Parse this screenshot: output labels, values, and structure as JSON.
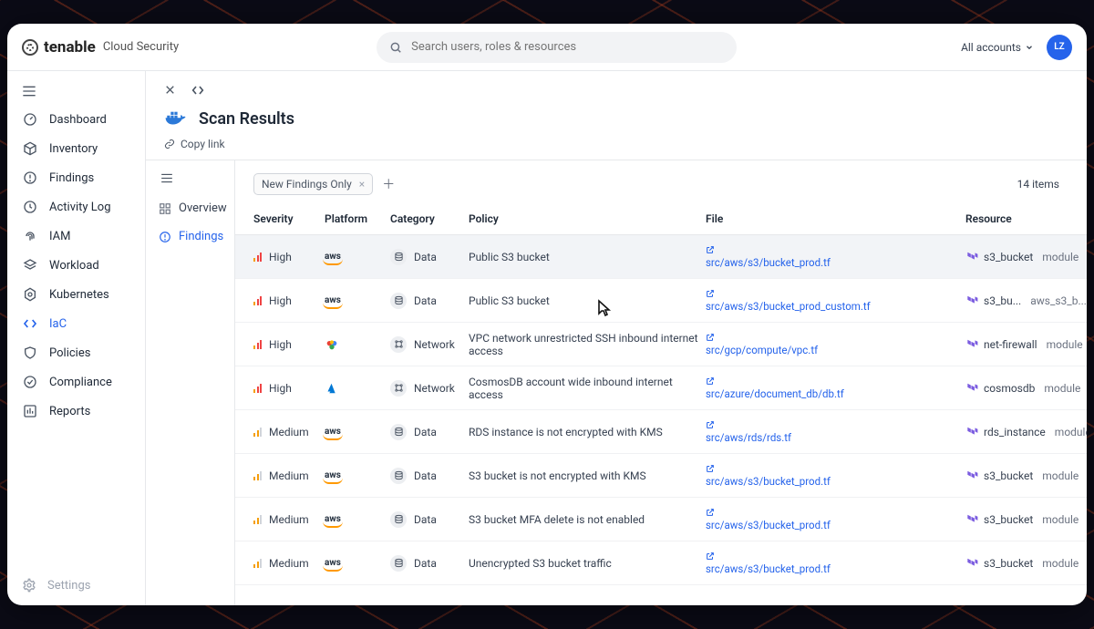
{
  "brand": {
    "name": "tenable",
    "sub": "Cloud Security"
  },
  "search": {
    "placeholder": "Search users, roles & resources"
  },
  "account": {
    "label": "All accounts",
    "avatar": "LZ"
  },
  "sidebar": {
    "items": [
      {
        "label": "Dashboard"
      },
      {
        "label": "Inventory"
      },
      {
        "label": "Findings"
      },
      {
        "label": "Activity Log"
      },
      {
        "label": "IAM"
      },
      {
        "label": "Workload"
      },
      {
        "label": "Kubernetes"
      },
      {
        "label": "IaC"
      },
      {
        "label": "Policies"
      },
      {
        "label": "Compliance"
      },
      {
        "label": "Reports"
      }
    ],
    "settings": "Settings"
  },
  "page": {
    "title": "Scan Results",
    "copy": "Copy link"
  },
  "subnav": {
    "overview": "Overview",
    "findings": "Findings"
  },
  "filter": {
    "chip": "New Findings Only",
    "count": "14 items"
  },
  "columns": {
    "severity": "Severity",
    "platform": "Platform",
    "category": "Category",
    "policy": "Policy",
    "file": "File",
    "resource": "Resource"
  },
  "labels": {
    "high": "High",
    "medium": "Medium",
    "data": "Data",
    "network": "Network",
    "module": "module"
  },
  "rows": [
    {
      "sev": "high",
      "plat": "aws",
      "cat": "data",
      "policy": "Public S3 bucket",
      "file": "src/aws/s3/bucket_prod.tf",
      "res": "s3_bucket",
      "mod": "module"
    },
    {
      "sev": "high",
      "plat": "aws",
      "cat": "data",
      "policy": "Public S3 bucket",
      "file": "src/aws/s3/bucket_prod_custom.tf",
      "res": "s3_bu...",
      "mod": "aws_s3_b..."
    },
    {
      "sev": "high",
      "plat": "gcp",
      "cat": "network",
      "policy": "VPC network unrestricted SSH inbound internet access",
      "file": "src/gcp/compute/vpc.tf",
      "res": "net-firewall",
      "mod": "module"
    },
    {
      "sev": "high",
      "plat": "azure",
      "cat": "network",
      "policy": "CosmosDB account wide inbound internet access",
      "file": "src/azure/document_db/db.tf",
      "res": "cosmosdb",
      "mod": "module"
    },
    {
      "sev": "medium",
      "plat": "aws",
      "cat": "data",
      "policy": "RDS instance is not encrypted with KMS",
      "file": "src/aws/rds/rds.tf",
      "res": "rds_instance",
      "mod": "module"
    },
    {
      "sev": "medium",
      "plat": "aws",
      "cat": "data",
      "policy": "S3 bucket is not encrypted with KMS",
      "file": "src/aws/s3/bucket_prod.tf",
      "res": "s3_bucket",
      "mod": "module"
    },
    {
      "sev": "medium",
      "plat": "aws",
      "cat": "data",
      "policy": "S3 bucket MFA delete is not enabled",
      "file": "src/aws/s3/bucket_prod.tf",
      "res": "s3_bucket",
      "mod": "module"
    },
    {
      "sev": "medium",
      "plat": "aws",
      "cat": "data",
      "policy": "Unencrypted S3 bucket traffic",
      "file": "src/aws/s3/bucket_prod.tf",
      "res": "s3_bucket",
      "mod": "module"
    }
  ]
}
